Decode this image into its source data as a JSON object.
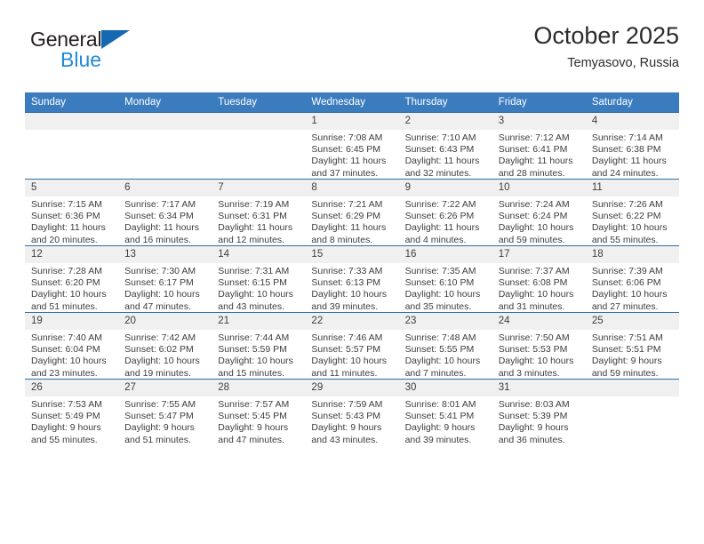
{
  "brand": {
    "name_top": "General",
    "name_bottom": "Blue",
    "triangle_color": "#1668b3",
    "blue_text_color": "#2389d6"
  },
  "header": {
    "title": "October 2025",
    "subtitle": "Temyasovo, Russia"
  },
  "colors": {
    "header_row_bg": "#3b7cbf",
    "day_number_bg": "#f0f0f0",
    "grid_line": "#2e6da4",
    "text": "#3d3d3d"
  },
  "weekday_headers": [
    "Sunday",
    "Monday",
    "Tuesday",
    "Wednesday",
    "Thursday",
    "Friday",
    "Saturday"
  ],
  "labels": {
    "sunrise_prefix": "Sunrise:",
    "sunset_prefix": "Sunset:",
    "daylight_prefix": "Daylight:"
  },
  "weeks": [
    [
      {
        "day": "",
        "empty": true
      },
      {
        "day": "",
        "empty": true
      },
      {
        "day": "",
        "empty": true
      },
      {
        "day": "1",
        "sunrise": "Sunrise: 7:08 AM",
        "sunset": "Sunset: 6:45 PM",
        "daylight_line1": "Daylight: 11 hours",
        "daylight_line2": "and 37 minutes."
      },
      {
        "day": "2",
        "sunrise": "Sunrise: 7:10 AM",
        "sunset": "Sunset: 6:43 PM",
        "daylight_line1": "Daylight: 11 hours",
        "daylight_line2": "and 32 minutes."
      },
      {
        "day": "3",
        "sunrise": "Sunrise: 7:12 AM",
        "sunset": "Sunset: 6:41 PM",
        "daylight_line1": "Daylight: 11 hours",
        "daylight_line2": "and 28 minutes."
      },
      {
        "day": "4",
        "sunrise": "Sunrise: 7:14 AM",
        "sunset": "Sunset: 6:38 PM",
        "daylight_line1": "Daylight: 11 hours",
        "daylight_line2": "and 24 minutes."
      }
    ],
    [
      {
        "day": "5",
        "sunrise": "Sunrise: 7:15 AM",
        "sunset": "Sunset: 6:36 PM",
        "daylight_line1": "Daylight: 11 hours",
        "daylight_line2": "and 20 minutes."
      },
      {
        "day": "6",
        "sunrise": "Sunrise: 7:17 AM",
        "sunset": "Sunset: 6:34 PM",
        "daylight_line1": "Daylight: 11 hours",
        "daylight_line2": "and 16 minutes."
      },
      {
        "day": "7",
        "sunrise": "Sunrise: 7:19 AM",
        "sunset": "Sunset: 6:31 PM",
        "daylight_line1": "Daylight: 11 hours",
        "daylight_line2": "and 12 minutes."
      },
      {
        "day": "8",
        "sunrise": "Sunrise: 7:21 AM",
        "sunset": "Sunset: 6:29 PM",
        "daylight_line1": "Daylight: 11 hours",
        "daylight_line2": "and 8 minutes."
      },
      {
        "day": "9",
        "sunrise": "Sunrise: 7:22 AM",
        "sunset": "Sunset: 6:26 PM",
        "daylight_line1": "Daylight: 11 hours",
        "daylight_line2": "and 4 minutes."
      },
      {
        "day": "10",
        "sunrise": "Sunrise: 7:24 AM",
        "sunset": "Sunset: 6:24 PM",
        "daylight_line1": "Daylight: 10 hours",
        "daylight_line2": "and 59 minutes."
      },
      {
        "day": "11",
        "sunrise": "Sunrise: 7:26 AM",
        "sunset": "Sunset: 6:22 PM",
        "daylight_line1": "Daylight: 10 hours",
        "daylight_line2": "and 55 minutes."
      }
    ],
    [
      {
        "day": "12",
        "sunrise": "Sunrise: 7:28 AM",
        "sunset": "Sunset: 6:20 PM",
        "daylight_line1": "Daylight: 10 hours",
        "daylight_line2": "and 51 minutes."
      },
      {
        "day": "13",
        "sunrise": "Sunrise: 7:30 AM",
        "sunset": "Sunset: 6:17 PM",
        "daylight_line1": "Daylight: 10 hours",
        "daylight_line2": "and 47 minutes."
      },
      {
        "day": "14",
        "sunrise": "Sunrise: 7:31 AM",
        "sunset": "Sunset: 6:15 PM",
        "daylight_line1": "Daylight: 10 hours",
        "daylight_line2": "and 43 minutes."
      },
      {
        "day": "15",
        "sunrise": "Sunrise: 7:33 AM",
        "sunset": "Sunset: 6:13 PM",
        "daylight_line1": "Daylight: 10 hours",
        "daylight_line2": "and 39 minutes."
      },
      {
        "day": "16",
        "sunrise": "Sunrise: 7:35 AM",
        "sunset": "Sunset: 6:10 PM",
        "daylight_line1": "Daylight: 10 hours",
        "daylight_line2": "and 35 minutes."
      },
      {
        "day": "17",
        "sunrise": "Sunrise: 7:37 AM",
        "sunset": "Sunset: 6:08 PM",
        "daylight_line1": "Daylight: 10 hours",
        "daylight_line2": "and 31 minutes."
      },
      {
        "day": "18",
        "sunrise": "Sunrise: 7:39 AM",
        "sunset": "Sunset: 6:06 PM",
        "daylight_line1": "Daylight: 10 hours",
        "daylight_line2": "and 27 minutes."
      }
    ],
    [
      {
        "day": "19",
        "sunrise": "Sunrise: 7:40 AM",
        "sunset": "Sunset: 6:04 PM",
        "daylight_line1": "Daylight: 10 hours",
        "daylight_line2": "and 23 minutes."
      },
      {
        "day": "20",
        "sunrise": "Sunrise: 7:42 AM",
        "sunset": "Sunset: 6:02 PM",
        "daylight_line1": "Daylight: 10 hours",
        "daylight_line2": "and 19 minutes."
      },
      {
        "day": "21",
        "sunrise": "Sunrise: 7:44 AM",
        "sunset": "Sunset: 5:59 PM",
        "daylight_line1": "Daylight: 10 hours",
        "daylight_line2": "and 15 minutes."
      },
      {
        "day": "22",
        "sunrise": "Sunrise: 7:46 AM",
        "sunset": "Sunset: 5:57 PM",
        "daylight_line1": "Daylight: 10 hours",
        "daylight_line2": "and 11 minutes."
      },
      {
        "day": "23",
        "sunrise": "Sunrise: 7:48 AM",
        "sunset": "Sunset: 5:55 PM",
        "daylight_line1": "Daylight: 10 hours",
        "daylight_line2": "and 7 minutes."
      },
      {
        "day": "24",
        "sunrise": "Sunrise: 7:50 AM",
        "sunset": "Sunset: 5:53 PM",
        "daylight_line1": "Daylight: 10 hours",
        "daylight_line2": "and 3 minutes."
      },
      {
        "day": "25",
        "sunrise": "Sunrise: 7:51 AM",
        "sunset": "Sunset: 5:51 PM",
        "daylight_line1": "Daylight: 9 hours",
        "daylight_line2": "and 59 minutes."
      }
    ],
    [
      {
        "day": "26",
        "sunrise": "Sunrise: 7:53 AM",
        "sunset": "Sunset: 5:49 PM",
        "daylight_line1": "Daylight: 9 hours",
        "daylight_line2": "and 55 minutes."
      },
      {
        "day": "27",
        "sunrise": "Sunrise: 7:55 AM",
        "sunset": "Sunset: 5:47 PM",
        "daylight_line1": "Daylight: 9 hours",
        "daylight_line2": "and 51 minutes."
      },
      {
        "day": "28",
        "sunrise": "Sunrise: 7:57 AM",
        "sunset": "Sunset: 5:45 PM",
        "daylight_line1": "Daylight: 9 hours",
        "daylight_line2": "and 47 minutes."
      },
      {
        "day": "29",
        "sunrise": "Sunrise: 7:59 AM",
        "sunset": "Sunset: 5:43 PM",
        "daylight_line1": "Daylight: 9 hours",
        "daylight_line2": "and 43 minutes."
      },
      {
        "day": "30",
        "sunrise": "Sunrise: 8:01 AM",
        "sunset": "Sunset: 5:41 PM",
        "daylight_line1": "Daylight: 9 hours",
        "daylight_line2": "and 39 minutes."
      },
      {
        "day": "31",
        "sunrise": "Sunrise: 8:03 AM",
        "sunset": "Sunset: 5:39 PM",
        "daylight_line1": "Daylight: 9 hours",
        "daylight_line2": "and 36 minutes."
      },
      {
        "day": "",
        "empty": true
      }
    ]
  ]
}
